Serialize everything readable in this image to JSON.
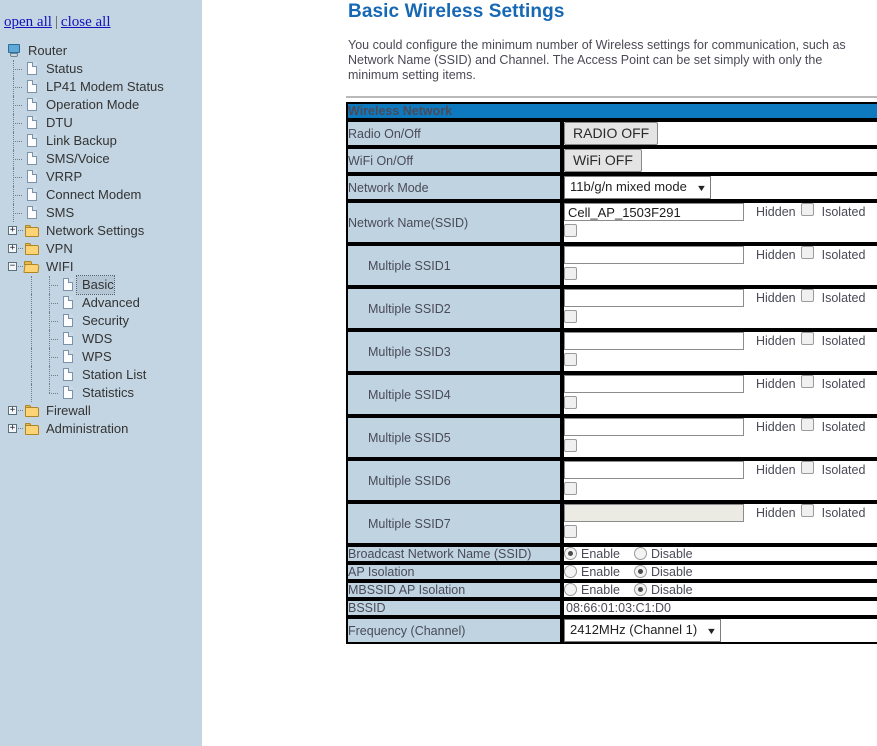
{
  "sidebar": {
    "open_all": "open all",
    "close_all": "close all",
    "separator": "|",
    "tree": [
      {
        "label": "Router",
        "level": 0,
        "icon": "router-icon",
        "toggle": "none",
        "selected": false
      },
      {
        "label": "Status",
        "level": 1,
        "icon": "document-icon",
        "toggle": "none",
        "selected": false
      },
      {
        "label": "LP41 Modem Status",
        "level": 1,
        "icon": "document-icon",
        "toggle": "none",
        "selected": false
      },
      {
        "label": "Operation Mode",
        "level": 1,
        "icon": "document-icon",
        "toggle": "none",
        "selected": false
      },
      {
        "label": "DTU",
        "level": 1,
        "icon": "document-icon",
        "toggle": "none",
        "selected": false
      },
      {
        "label": "Link Backup",
        "level": 1,
        "icon": "document-icon",
        "toggle": "none",
        "selected": false
      },
      {
        "label": "SMS/Voice",
        "level": 1,
        "icon": "document-icon",
        "toggle": "none",
        "selected": false
      },
      {
        "label": "VRRP",
        "level": 1,
        "icon": "document-icon",
        "toggle": "none",
        "selected": false
      },
      {
        "label": "Connect Modem",
        "level": 1,
        "icon": "document-icon",
        "toggle": "none",
        "selected": false
      },
      {
        "label": "SMS",
        "level": 1,
        "icon": "document-icon",
        "toggle": "none",
        "selected": false
      },
      {
        "label": "Network Settings",
        "level": 1,
        "icon": "folder-closed-icon",
        "toggle": "plus",
        "selected": false
      },
      {
        "label": "VPN",
        "level": 1,
        "icon": "folder-closed-icon",
        "toggle": "plus",
        "selected": false
      },
      {
        "label": "WIFI",
        "level": 1,
        "icon": "folder-open-icon",
        "toggle": "minus",
        "selected": false
      },
      {
        "label": "Basic",
        "level": 2,
        "icon": "document-icon",
        "toggle": "none",
        "selected": true
      },
      {
        "label": "Advanced",
        "level": 2,
        "icon": "document-icon",
        "toggle": "none",
        "selected": false
      },
      {
        "label": "Security",
        "level": 2,
        "icon": "document-icon",
        "toggle": "none",
        "selected": false
      },
      {
        "label": "WDS",
        "level": 2,
        "icon": "document-icon",
        "toggle": "none",
        "selected": false
      },
      {
        "label": "WPS",
        "level": 2,
        "icon": "document-icon",
        "toggle": "none",
        "selected": false
      },
      {
        "label": "Station List",
        "level": 2,
        "icon": "document-icon",
        "toggle": "none",
        "selected": false
      },
      {
        "label": "Statistics",
        "level": 2,
        "icon": "document-icon",
        "toggle": "none",
        "selected": false
      },
      {
        "label": "Firewall",
        "level": 1,
        "icon": "folder-closed-icon",
        "toggle": "plus",
        "selected": false
      },
      {
        "label": "Administration",
        "level": 1,
        "icon": "folder-closed-icon",
        "toggle": "plus",
        "selected": false
      }
    ]
  },
  "page": {
    "title": "Basic Wireless Settings",
    "description": "You could configure the minimum number of Wireless settings for communication, such as Network Name (SSID) and Channel. The Access Point can be set simply with only the minimum setting items."
  },
  "form": {
    "section_title": "Wireless Network",
    "radio_onoff": {
      "label": "Radio On/Off",
      "button": "RADIO OFF"
    },
    "wifi_onoff": {
      "label": "WiFi On/Off",
      "button": "WiFi OFF"
    },
    "network_mode": {
      "label": "Network Mode",
      "value": "11b/g/n mixed mode",
      "caret": "▼"
    },
    "hidden_label": "Hidden",
    "isolated_label": "Isolated",
    "ssid_rows": [
      {
        "label": "Network Name(SSID)",
        "value": "Cell_AP_1503F291",
        "placeholder": "",
        "disabled": false,
        "hidden_checked": false,
        "isolated_checked": false,
        "indent": false
      },
      {
        "label": "Multiple SSID1",
        "value": "",
        "placeholder": "",
        "disabled": false,
        "hidden_checked": false,
        "isolated_checked": false,
        "indent": true
      },
      {
        "label": "Multiple SSID2",
        "value": "",
        "placeholder": "",
        "disabled": false,
        "hidden_checked": false,
        "isolated_checked": false,
        "indent": true
      },
      {
        "label": "Multiple SSID3",
        "value": "",
        "placeholder": "",
        "disabled": false,
        "hidden_checked": false,
        "isolated_checked": false,
        "indent": true
      },
      {
        "label": "Multiple SSID4",
        "value": "",
        "placeholder": "",
        "disabled": false,
        "hidden_checked": false,
        "isolated_checked": false,
        "indent": true
      },
      {
        "label": "Multiple SSID5",
        "value": "",
        "placeholder": "",
        "disabled": false,
        "hidden_checked": false,
        "isolated_checked": false,
        "indent": true
      },
      {
        "label": "Multiple SSID6",
        "value": "",
        "placeholder": "",
        "disabled": false,
        "hidden_checked": false,
        "isolated_checked": false,
        "indent": true
      },
      {
        "label": "Multiple SSID7",
        "value": "",
        "placeholder": "",
        "disabled": true,
        "hidden_checked": false,
        "isolated_checked": false,
        "indent": true
      }
    ],
    "radio_rows": [
      {
        "label": "Broadcast Network Name (SSID)",
        "enable_label": "Enable",
        "disable_label": "Disable",
        "selected": "enable"
      },
      {
        "label": "AP Isolation",
        "enable_label": "Enable",
        "disable_label": "Disable",
        "selected": "disable"
      },
      {
        "label": "MBSSID AP Isolation",
        "enable_label": "Enable",
        "disable_label": "Disable",
        "selected": "disable"
      }
    ],
    "bssid": {
      "label": "BSSID",
      "value": "08:66:01:03:C1:D0"
    },
    "frequency": {
      "label": "Frequency (Channel)",
      "value": "2412MHz (Channel 1)",
      "caret": "▼"
    }
  },
  "colors": {
    "accent_blue": "#0d7ac0",
    "title_blue": "#1668b5",
    "label_cell": "#bfd3e0",
    "sidebar_bg": "#c3d5e2",
    "link_blue": "#1212bb"
  }
}
